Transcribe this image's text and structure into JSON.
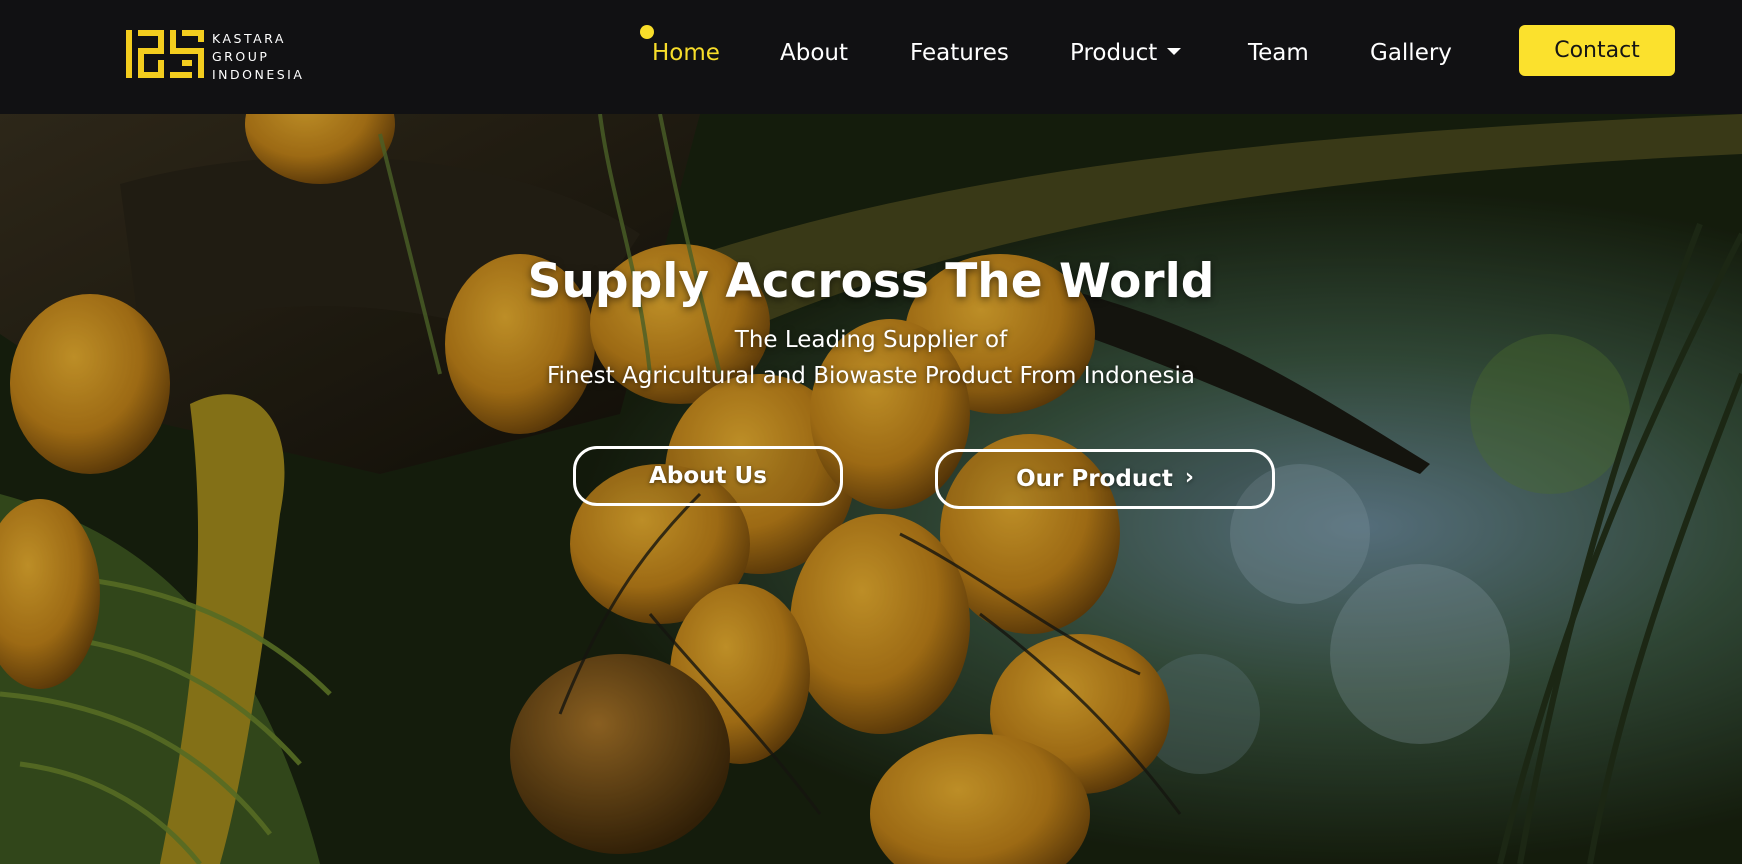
{
  "brand": {
    "logo_line1": "KASTARA",
    "logo_line2": "GROUP",
    "logo_line3": "INDONESIA",
    "accent_color": "#fbe12d"
  },
  "nav": {
    "items": [
      {
        "label": "Home",
        "active": true
      },
      {
        "label": "About"
      },
      {
        "label": "Features"
      },
      {
        "label": "Product",
        "has_dropdown": true
      },
      {
        "label": "Team"
      },
      {
        "label": "Gallery"
      }
    ],
    "contact_label": "Contact"
  },
  "hero": {
    "title": "Supply Accross The World",
    "subtitle_line1": "The Leading Supplier of",
    "subtitle_line2": "Finest Agricultural and Biowaste Product From Indonesia",
    "button_about": "About Us",
    "button_product": "Our Product",
    "button_product_icon": "chevron-right-icon"
  }
}
